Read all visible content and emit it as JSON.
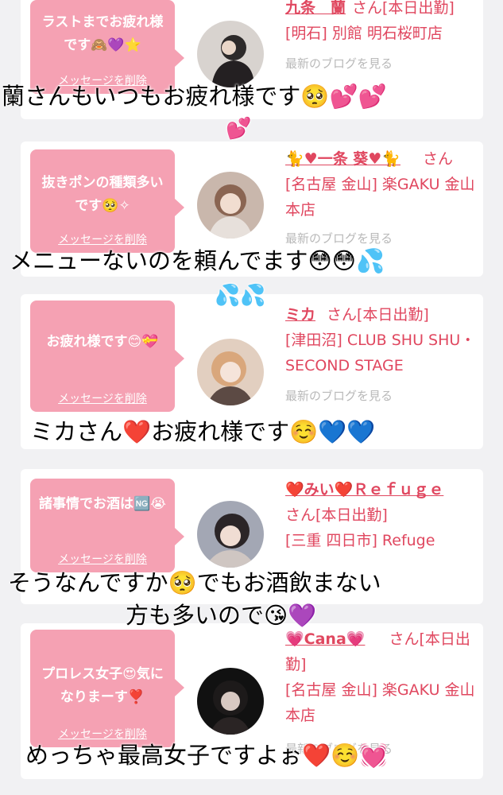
{
  "messages": [
    {
      "text": "ラストまでお疲れ様です🙈💜⭐",
      "delete_label": "メッセージを削除",
      "name": "九条　蘭",
      "suffix": "さん[本日出勤]",
      "shop": "[明石] 別館 明石桜町店",
      "blog_link": "最新のブログを見る",
      "caption": "蘭さんもいつもお疲れ様です🥺💕💕",
      "caption_line2": "💕"
    },
    {
      "text": "抜きポンの種類多いです🥺✧",
      "delete_label": "メッセージを削除",
      "name": "🐈♥一条 葵♥🐈",
      "suffix": "さん",
      "shop": "[名古屋 金山] 楽GAKU 金山本店",
      "blog_link": "最新のブログを見る",
      "caption": "メニューないのを頼んでます😳😳💦",
      "caption_line2": "💦💦"
    },
    {
      "text": "お疲れ様です😊💝",
      "delete_label": "メッセージを削除",
      "name": "ミカ",
      "suffix": "さん[本日出勤]",
      "shop": "[津田沼] CLUB SHU SHU・SECOND STAGE",
      "blog_link": "最新のブログを見る",
      "caption": "ミカさん❤️お疲れ様です☺️💙💙",
      "caption_line2": ""
    },
    {
      "text": "諸事情でお酒は🆖😭",
      "delete_label": "メッセージを削除",
      "name": "❤️みい❤️Ｒｅｆｕｇｅ",
      "suffix": "さん[本日出勤]",
      "shop": "[三重 四日市] Refuge",
      "blog_link": "最新のブログを見る",
      "caption": "そうなんですか🥺でもお酒飲まない",
      "caption_line2": "方も多いので😘💜"
    },
    {
      "text": "プロレス女子😍気になりまーす❣️",
      "delete_label": "メッセージを削除",
      "name": "💗Cana💗",
      "suffix": "さん[本日出勤]",
      "shop": "[名古屋 金山] 楽GAKU 金山本店",
      "blog_link": "最新のブログを見る",
      "caption": "めっちゃ最高女子ですよぉ❤️☺️💓",
      "caption_line2": ""
    }
  ],
  "colors": {
    "bubble": "#f5a1b3",
    "accent": "#e0475f",
    "background": "#f1f1f3"
  }
}
